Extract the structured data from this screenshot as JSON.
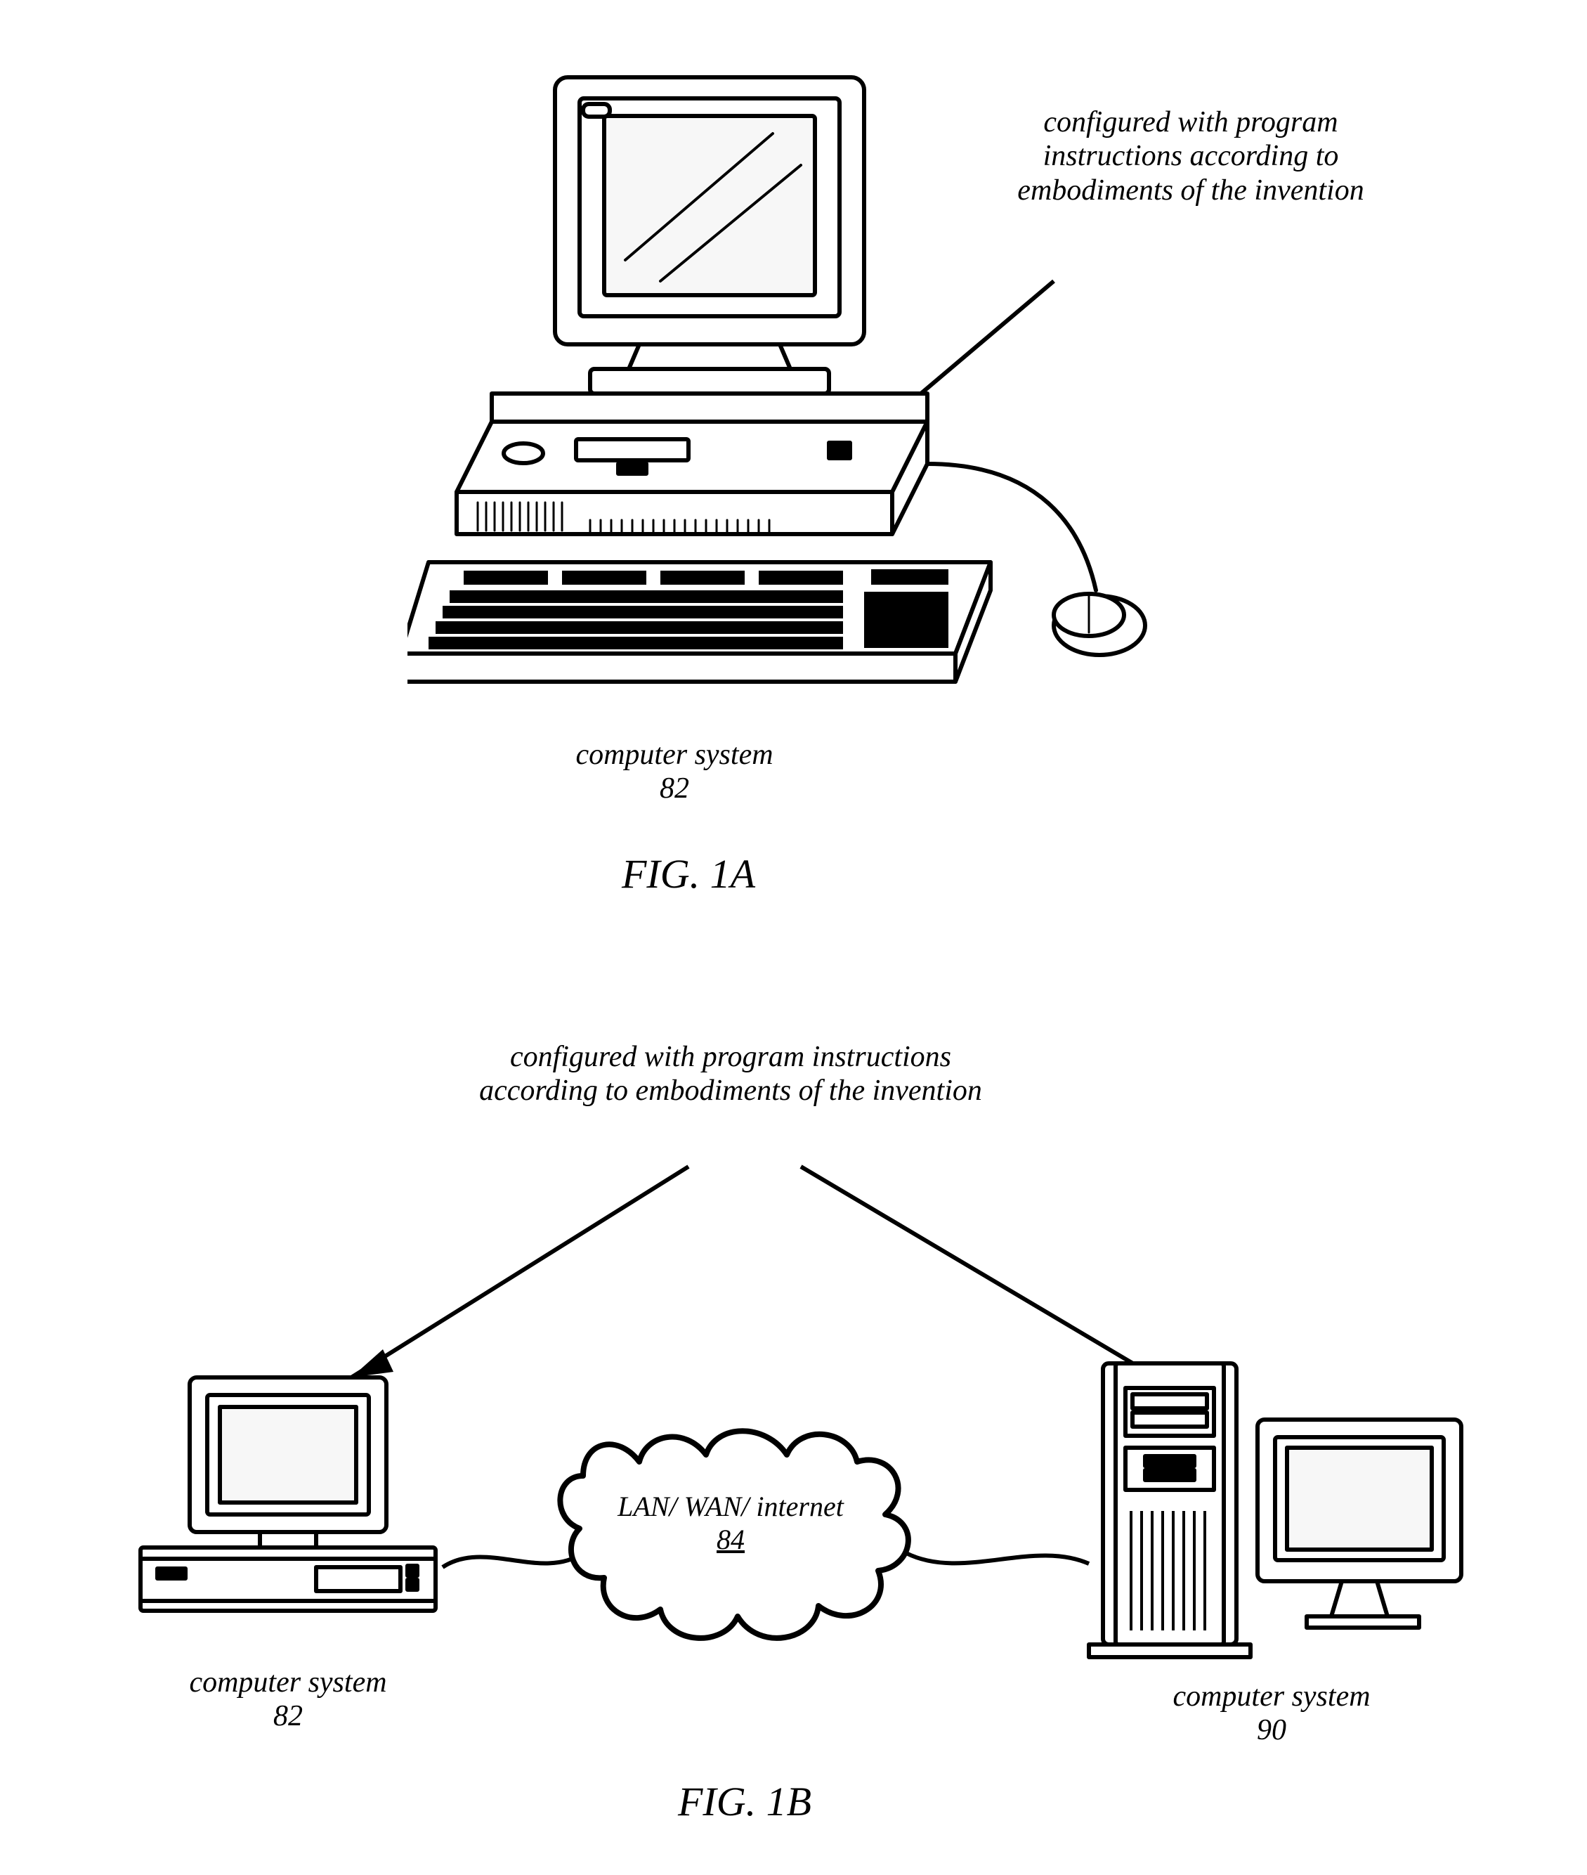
{
  "fig1a": {
    "annotation": "configured with program instructions according to embodiments of the invention",
    "computer_label": "computer system",
    "computer_ref": "82",
    "caption": "FIG. 1A"
  },
  "fig1b": {
    "annotation": "configured with program instructions according to embodiments of the invention",
    "cloud_line1": "LAN/ WAN/ internet",
    "cloud_ref": "84",
    "left_label": "computer system",
    "left_ref": "82",
    "right_label": "computer system",
    "right_ref": "90",
    "caption": "FIG. 1B"
  }
}
